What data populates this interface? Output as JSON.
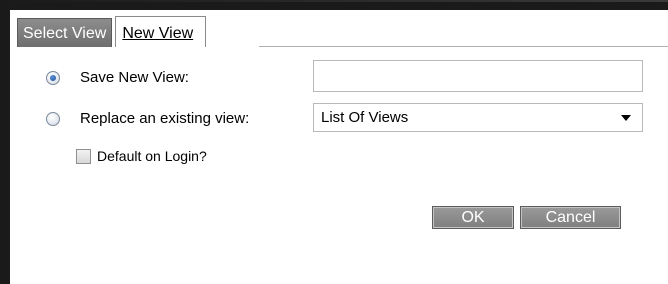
{
  "tabs": {
    "select_view": "Select View",
    "new_view": "New View"
  },
  "options": {
    "save_new_label": "Save New View:",
    "save_new_value": "",
    "replace_label": "Replace an existing view:",
    "replace_selected": "List Of Views",
    "default_login_label": "Default on Login?"
  },
  "buttons": {
    "ok": "OK",
    "cancel": "Cancel"
  },
  "colors": {
    "frame": "#1a1a1a",
    "active_tab": "#7d7d7d",
    "button": "#8a8a8a",
    "radio_selected": "#1a4f9a"
  }
}
